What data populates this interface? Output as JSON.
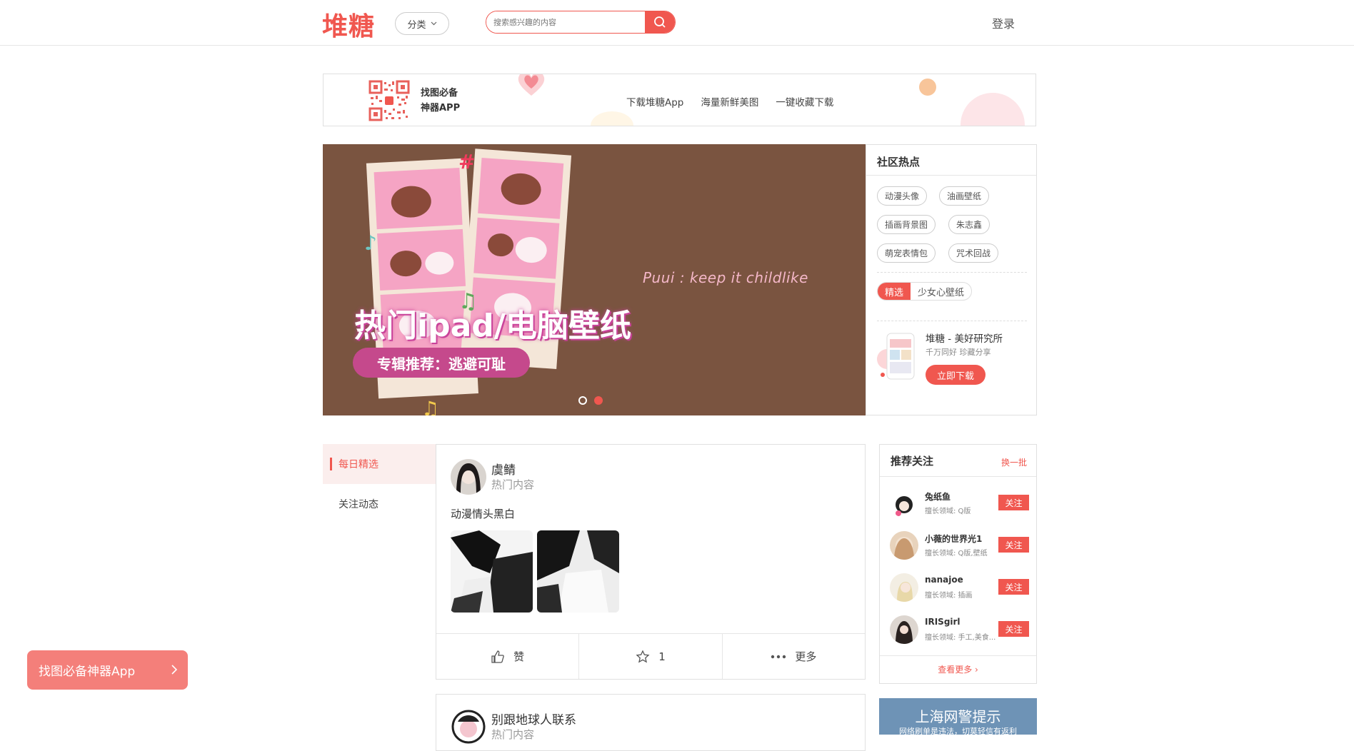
{
  "header": {
    "logo": "堆糖",
    "category_label": "分类",
    "search_placeholder": "搜索感兴趣的内容",
    "login_label": "登录"
  },
  "app_banner": {
    "line1": "找图必备",
    "line2": "神器APP",
    "links": [
      "下载堆糖App",
      "海量新鲜美图",
      "一键收藏下载"
    ]
  },
  "carousel": {
    "slogan": "Puui : keep it childlike",
    "title": "热门ipad/电脑壁纸",
    "subtitle": "专辑推荐：逃避可耻",
    "dots": [
      false,
      true
    ]
  },
  "hot": {
    "title": "社区热点",
    "tags": [
      "动漫头像",
      "油画壁纸",
      "插画背景图",
      "朱志鑫",
      "萌宠表情包",
      "咒术回战"
    ],
    "segments": [
      "精选",
      "少女心壁纸"
    ],
    "download_title": "堆糖 - 美好研究所",
    "download_sub": "千万同好 珍藏分享",
    "download_btn": "立即下载"
  },
  "left_nav": {
    "items": [
      "每日精选",
      "关注动态"
    ]
  },
  "feed": {
    "post1": {
      "user": "虞鲭",
      "sub": "热门内容",
      "text": "动漫情头黑白",
      "like_label": "赞",
      "fav_count": "1",
      "more_label": "更多"
    },
    "post2": {
      "user": "别跟地球人联系",
      "sub": "热门内容"
    }
  },
  "recommend": {
    "title": "推荐关注",
    "swap": "换一批",
    "follow_label": "关注",
    "users": [
      {
        "name": "兔纸鱼",
        "field": "擅长领域: Q版"
      },
      {
        "name": "小薇的世界光1",
        "field": "擅长领域: Q版,壁纸"
      },
      {
        "name": "nanajoe",
        "field": "擅长领域: 插画"
      },
      {
        "name": "IRISgirl",
        "field": "擅长领域: 手工,美食..."
      }
    ],
    "more": "查看更多 ›"
  },
  "police": {
    "title": "上海网警提示",
    "sub": "网络刷单是违法，切莫轻信有返利"
  },
  "float_app": {
    "label": "找图必备神器App"
  },
  "colors": {
    "accent": "#f0574f",
    "carousel_bg": "#7a5440"
  }
}
